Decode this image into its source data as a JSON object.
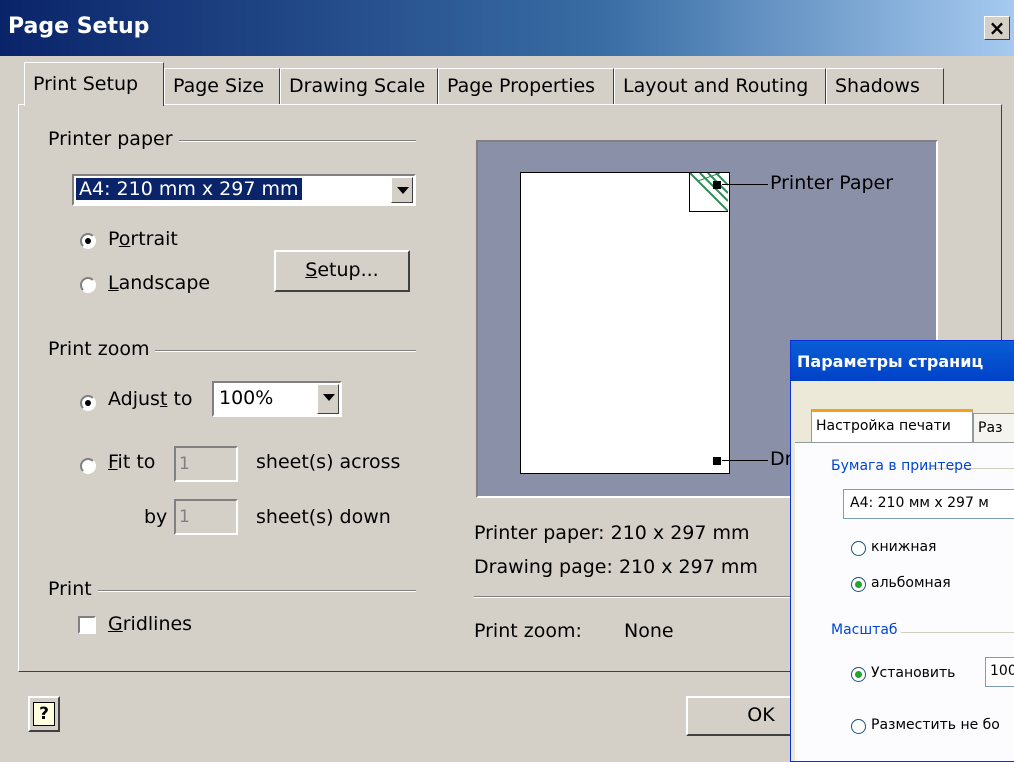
{
  "window": {
    "title": "Page Setup",
    "close": "×"
  },
  "tabs": [
    "Print Setup",
    "Page Size",
    "Drawing Scale",
    "Page Properties",
    "Layout and Routing",
    "Shadows"
  ],
  "printer_paper": {
    "group_label": "Printer paper",
    "selected": "A4:  210 mm x 297 mm",
    "portrait_pre": "P",
    "portrait_u": "o",
    "portrait_post": "rtrait",
    "landscape_u": "L",
    "landscape_post": "andscape",
    "orientation": "Portrait",
    "setup_u": "S",
    "setup_post": "etup..."
  },
  "print_zoom": {
    "group_label": "Print zoom",
    "adjust_pre": "Adjus",
    "adjust_u": "t",
    "adjust_post": " to",
    "adjust_value": "100%",
    "fit_u": "F",
    "fit_post": "it to",
    "across_value": "1",
    "across_label": "sheet(s) across",
    "by_label": "by",
    "down_value": "1",
    "down_label": "sheet(s) down"
  },
  "print": {
    "group_label": "Print",
    "gridlines_u": "G",
    "gridlines_post": "ridlines",
    "gridlines_checked": false
  },
  "preview": {
    "printer_paper_callout": "Printer Paper",
    "drawing_page_callout": "Dr",
    "info_printer_paper": "Printer paper:  210 x 297 mm",
    "info_drawing_page": "Drawing page: 210 x 297 mm",
    "info_zoom_label": "Print zoom:",
    "info_zoom_value": "None"
  },
  "buttons": {
    "help": "?",
    "ok": "OK"
  },
  "ru_dialog": {
    "title": "Параметры страниц",
    "tab_active": "Настройка печати",
    "tab_next": "Раз",
    "paper_group": "Бумага в принтере",
    "paper_value": "A4:  210 мм x 297 м",
    "portrait": "книжная",
    "landscape": "альбомная",
    "zoom_group": "Масштаб",
    "adjust": "Установить",
    "adjust_value": "100",
    "fit": "Разместить не бо"
  }
}
